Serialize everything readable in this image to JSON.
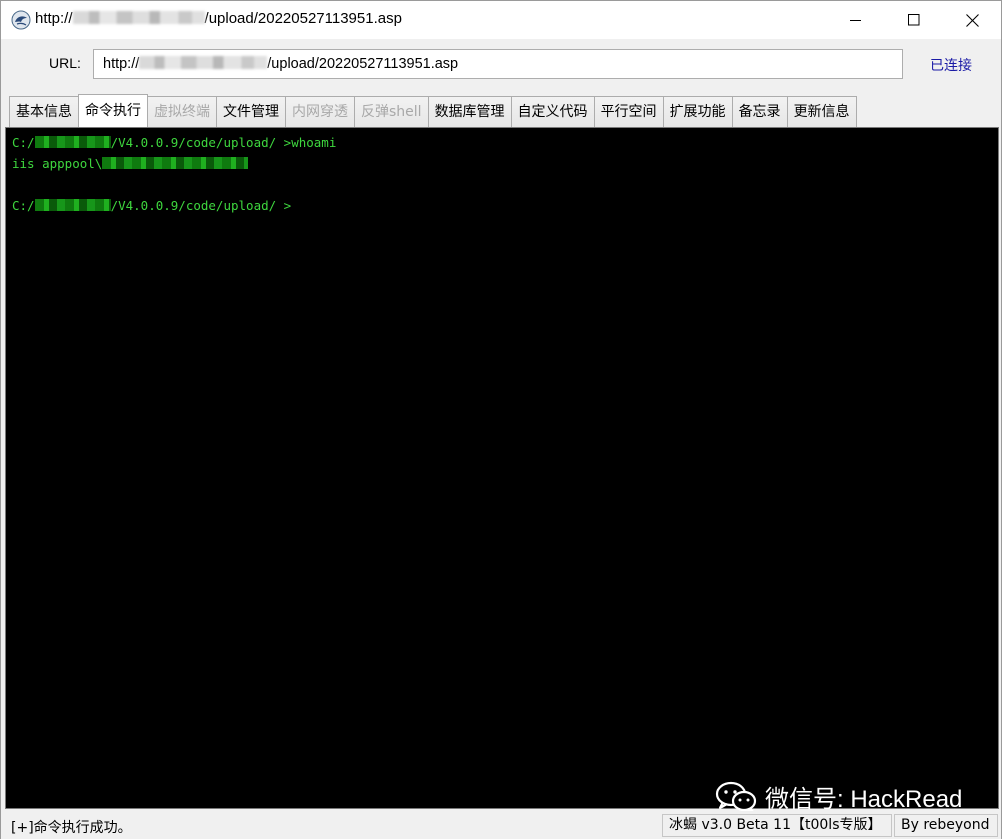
{
  "window": {
    "title_prefix": "http://",
    "title_suffix": "/upload/20220527113951.asp",
    "buttons": {
      "minimize": "minimize-icon",
      "maximize": "maximize-icon",
      "close": "close-icon"
    }
  },
  "url_bar": {
    "label": "URL:",
    "value_prefix": "http://",
    "value_suffix": "/upload/20220527113951.asp",
    "status": "已连接"
  },
  "tabs": [
    {
      "label": "基本信息",
      "state": "normal"
    },
    {
      "label": "命令执行",
      "state": "active"
    },
    {
      "label": "虚拟终端",
      "state": "disabled"
    },
    {
      "label": "文件管理",
      "state": "normal"
    },
    {
      "label": "内网穿透",
      "state": "disabled"
    },
    {
      "label": "反弹shell",
      "state": "disabled"
    },
    {
      "label": "数据库管理",
      "state": "normal"
    },
    {
      "label": "自定义代码",
      "state": "normal"
    },
    {
      "label": "平行空间",
      "state": "normal"
    },
    {
      "label": "扩展功能",
      "state": "normal"
    },
    {
      "label": "备忘录",
      "state": "normal"
    },
    {
      "label": "更新信息",
      "state": "normal"
    }
  ],
  "terminal": {
    "line1_prefix": "C:/",
    "line1_path": "/V4.0.0.9/code/upload/ ",
    "line1_cmd": ">whoami",
    "line2": "iis apppool\\",
    "line3_prefix": "C:/",
    "line3_path": "/V4.0.0.9/code/upload/ ",
    "line3_prompt": ">",
    "text_color": "#3ed63e",
    "background": "#000000"
  },
  "watermark": {
    "text": "微信号: HackRead",
    "icon": "wechat-icon"
  },
  "status_bar": {
    "message": "[+]命令执行成功。",
    "version": "冰蝎 v3.0 Beta 11【t00ls专版】",
    "author": "By rebeyond"
  },
  "colors": {
    "status_link": "#1a1aa6",
    "disabled_tab": "#a8a8a8"
  }
}
